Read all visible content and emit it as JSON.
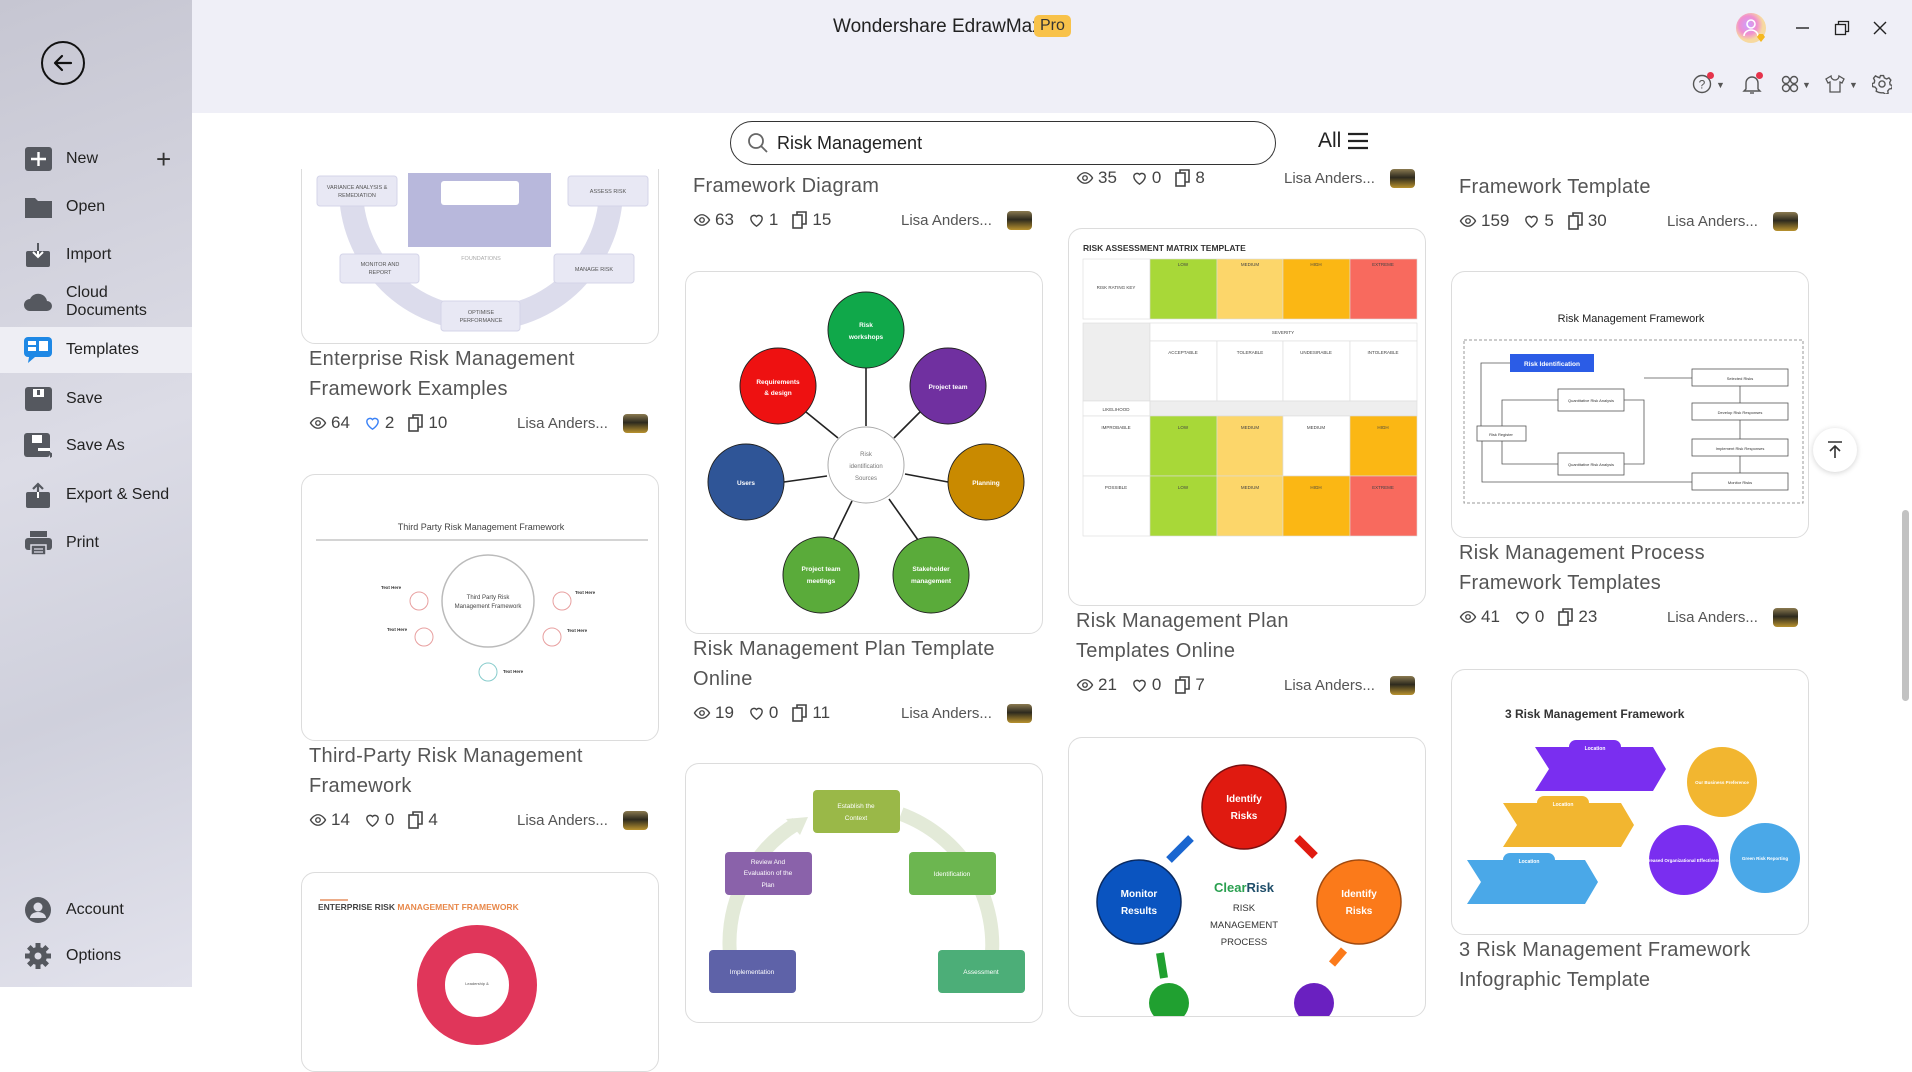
{
  "app": {
    "title": "Wondershare EdrawMax",
    "badge": "Pro"
  },
  "sidebar": {
    "items": [
      {
        "label": "New",
        "icon": "plus-square-icon"
      },
      {
        "label": "Open",
        "icon": "folder-icon"
      },
      {
        "label": "Import",
        "icon": "import-icon"
      },
      {
        "label": "Cloud Documents",
        "icon": "cloud-icon"
      },
      {
        "label": "Templates",
        "icon": "templates-icon",
        "active": true
      },
      {
        "label": "Save",
        "icon": "save-icon"
      },
      {
        "label": "Save As",
        "icon": "save-as-icon"
      },
      {
        "label": "Export & Send",
        "icon": "export-icon"
      },
      {
        "label": "Print",
        "icon": "printer-icon"
      }
    ],
    "bottom": [
      {
        "label": "Account",
        "icon": "account-icon"
      },
      {
        "label": "Options",
        "icon": "gear-icon"
      }
    ]
  },
  "search": {
    "value": "Risk Management",
    "filter_label": "All"
  },
  "colors": {
    "accent": "#1e88e5",
    "badge": "#f8c24a",
    "notification": "#e5334b",
    "liked": "#3b82f6"
  },
  "cards": [
    {
      "title_lines": [
        "Enterprise Risk Management",
        "Framework Examples"
      ],
      "views": "64",
      "likes": "2",
      "copies": "10",
      "author": "Lisa Anders...",
      "liked": true,
      "thumb": {
        "labels": [
          "VARIANCE ANALYSIS &",
          "REMEDIATION",
          "ASSESS RISK",
          "MONITOR AND",
          "REPORT",
          "MANAGE RISK",
          "OPTIMISE",
          "PERFORMANCE",
          "FOUNDATIONS"
        ]
      }
    },
    {
      "title_lines": [
        "Third-Party Risk Management",
        "Framework"
      ],
      "views": "14",
      "likes": "0",
      "copies": "4",
      "author": "Lisa Anders...",
      "thumb": {
        "title": "Third Party Risk Management Framework",
        "center": [
          "Third Party Risk",
          "Management Framework"
        ],
        "item": "Text Here"
      }
    },
    {
      "thumb": {
        "title_a": "ENTERPRISE RISK ",
        "title_b": "MANAGEMENT FRAMEWORK",
        "center": "Leadership &"
      }
    },
    {
      "title_lines": [
        "Framework Diagram"
      ],
      "views": "63",
      "likes": "1",
      "copies": "15",
      "author": "Lisa Anders..."
    },
    {
      "title_lines": [
        "Risk Management Plan Template",
        "Online"
      ],
      "views": "19",
      "likes": "0",
      "copies": "11",
      "author": "Lisa Anders...",
      "thumb": {
        "center": [
          "Risk",
          "identification",
          "Sources"
        ],
        "nodes": [
          [
            "Risk",
            "workshops"
          ],
          [
            "Requirements",
            "& design"
          ],
          [
            "Project team"
          ],
          [
            "Users"
          ],
          [
            "Planning"
          ],
          [
            "Project team",
            "meetings"
          ],
          [
            "Stakeholder",
            "management"
          ]
        ]
      }
    },
    {
      "thumb": {
        "nodes": [
          [
            "Establish the",
            "Context"
          ],
          [
            "Review And",
            "Evaluation of the",
            "Plan"
          ],
          [
            "Identification"
          ],
          [
            "Implementation"
          ],
          [
            "Assessment"
          ]
        ]
      }
    },
    {
      "views": "35",
      "likes": "0",
      "copies": "8",
      "author": "Lisa Anders..."
    },
    {
      "title_lines": [
        "Risk Management Plan",
        "Templates Online"
      ],
      "views": "21",
      "likes": "0",
      "copies": "7",
      "author": "Lisa Anders...",
      "thumb": {
        "title": "RISK ASSESSMENT MATRIX TEMPLATE",
        "levels": [
          "LOW",
          "MEDIUM",
          "HIGH",
          "EXTREME"
        ],
        "key": "RISK RATING KEY",
        "severity": "SEVERITY",
        "severities": [
          "ACCEPTABLE",
          "TOLERABLE",
          "UNDESIRABLE",
          "INTOLERABLE"
        ],
        "likelihood": "LIKELIHOOD",
        "rows": [
          "IMPROBABLE",
          "POSSIBLE"
        ],
        "improbable_row": [
          "LOW",
          "MEDIUM",
          "MEDIUM",
          "HIGH"
        ],
        "possible_row": [
          "LOW",
          "MEDIUM",
          "HIGH",
          "EXTREME"
        ]
      }
    },
    {
      "thumb": {
        "nodes": [
          [
            "Identify",
            "Risks"
          ],
          [
            "Identify",
            "Risks"
          ],
          [
            "Monitor",
            "Results"
          ]
        ],
        "brand_a": "Clear",
        "brand_b": "Risk",
        "center": [
          "RISK",
          "MANAGEMENT",
          "PROCESS"
        ]
      }
    },
    {
      "title_lines": [
        "Framework Template"
      ],
      "views": "159",
      "likes": "5",
      "copies": "30",
      "author": "Lisa Anders..."
    },
    {
      "title_lines": [
        "Risk Management Process",
        "Framework Templates"
      ],
      "views": "41",
      "likes": "0",
      "copies": "23",
      "author": "Lisa Anders...",
      "thumb": {
        "title": "Risk Management Framework",
        "highlight": "Risk Identification",
        "boxes": [
          "Quantitative Risk Analysis",
          "Risk Register",
          "Quantitative Risk Analysis",
          "Selected Risks",
          "Develop Risk Responses",
          "Implement Risk Responses",
          "Monitor Risks"
        ]
      }
    },
    {
      "title_lines": [
        "3 Risk Management Framework",
        "Infographic Template"
      ],
      "thumb": {
        "title": "3 Risk Management Framework",
        "tag": "Location",
        "gears": [
          "Our Business Preference",
          "Increased Organizational Effectiveness",
          "Green Risk Reporting"
        ]
      }
    }
  ]
}
